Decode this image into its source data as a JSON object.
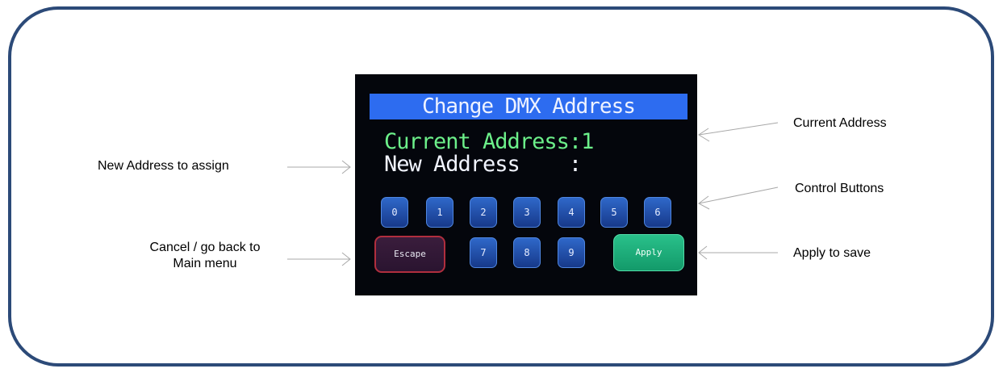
{
  "device": {
    "title": "Change DMX Address",
    "current_address_line": "Current Address:1",
    "new_address_line": "New Address    :",
    "keys": [
      "0",
      "1",
      "2",
      "3",
      "4",
      "5",
      "6",
      "7",
      "8",
      "9"
    ],
    "escape_label": "Escape",
    "apply_label": "Apply"
  },
  "annotations": {
    "new_address": "New Address to assign",
    "cancel_line1": "Cancel / go back to",
    "cancel_line2": "Main menu",
    "current_address": "Current Address",
    "control_buttons": "Control Buttons",
    "apply_to_save": "Apply to save"
  },
  "colors": {
    "frame": "#2c4a78",
    "screen": "#04060c",
    "title_bar": "#2d6cf0",
    "current_text": "#6cf08a",
    "key": "#2456b4",
    "escape_border": "#b02e3e",
    "apply": "#1fae7a"
  }
}
